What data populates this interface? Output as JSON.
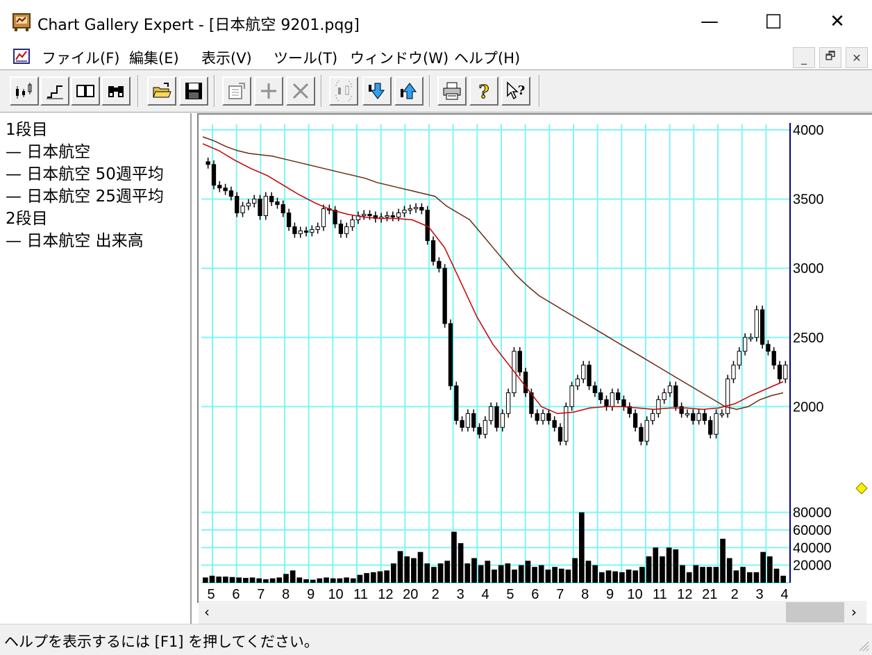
{
  "window": {
    "title": "Chart Gallery Expert - [日本航空 9201.pqg]",
    "minimize": "—",
    "maximize": "☐",
    "close": "✕"
  },
  "menu": [
    {
      "label": "ファイル(F)"
    },
    {
      "label": "編集(E)"
    },
    {
      "label": "表示(V)"
    },
    {
      "label": "ツール(T)"
    },
    {
      "label": "ウィンドウ(W)"
    },
    {
      "label": "ヘルプ(H)"
    }
  ],
  "mdi": {
    "minimize": "_",
    "restore": "🗗",
    "close": "✕"
  },
  "toolbar": [
    {
      "icon": "candlestick-chart-icon"
    },
    {
      "icon": "step-line-icon"
    },
    {
      "icon": "split-view-icon"
    },
    {
      "icon": "binoculars-icon"
    },
    {
      "icon": "open-folder-icon"
    },
    {
      "icon": "save-disk-icon"
    },
    {
      "icon": "properties-icon"
    },
    {
      "icon": "add-plus-icon"
    },
    {
      "icon": "delete-x-icon"
    },
    {
      "icon": "candle-refresh-icon"
    },
    {
      "icon": "move-down-icon"
    },
    {
      "icon": "move-up-icon"
    },
    {
      "icon": "print-icon"
    },
    {
      "icon": "help-question-icon"
    },
    {
      "icon": "context-help-icon"
    }
  ],
  "legend": [
    {
      "text": "1段目"
    },
    {
      "text": "— 日本航空",
      "color": "#000000"
    },
    {
      "text": "— 日本航空 50週平均",
      "color": "#7a2a10"
    },
    {
      "text": "— 日本航空 25週平均",
      "color": "#c00000"
    },
    {
      "text": "2段目"
    },
    {
      "text": "— 日本航空 出来高",
      "color": "#000000"
    }
  ],
  "status": "ヘルプを表示するには [F1] を押してください。",
  "colors": {
    "grid": "#7ff5f5",
    "axis": "#000080",
    "ma50": "#6b2a10",
    "ma25": "#c80000",
    "candle": "#000000",
    "marker": "#ffee00"
  },
  "chart_data": {
    "type": "candlestick",
    "panes": [
      {
        "name": "price",
        "ylim": [
          1500,
          4000
        ],
        "yticks": [
          4000,
          3500,
          3000,
          2500,
          2000
        ]
      },
      {
        "name": "volume",
        "ylim": [
          0,
          90000
        ],
        "yticks": [
          80000,
          60000,
          40000,
          20000
        ]
      }
    ],
    "x_tick_labels": [
      "5",
      "6",
      "7",
      "8",
      "9",
      "10",
      "11",
      "12",
      "20",
      "2",
      "3",
      "4",
      "5",
      "6",
      "7",
      "8",
      "9",
      "10",
      "11",
      "12",
      "21",
      "2",
      "3",
      "4"
    ],
    "price_close": [
      3750,
      3600,
      3580,
      3560,
      3520,
      3400,
      3450,
      3470,
      3500,
      3380,
      3520,
      3480,
      3460,
      3400,
      3300,
      3250,
      3270,
      3260,
      3280,
      3300,
      3430,
      3420,
      3320,
      3250,
      3300,
      3350,
      3380,
      3390,
      3380,
      3360,
      3370,
      3380,
      3370,
      3400,
      3420,
      3430,
      3440,
      3420,
      3200,
      3050,
      3000,
      2600,
      2150,
      1900,
      1850,
      1950,
      1850,
      1800,
      1900,
      2000,
      1850,
      1950,
      2100,
      2400,
      2250,
      2100,
      1950,
      1900,
      1950,
      1900,
      1850,
      1750,
      2000,
      2150,
      2200,
      2300,
      2150,
      2100,
      2050,
      2000,
      2100,
      2050,
      2000,
      1950,
      1850,
      1750,
      1900,
      1950,
      2050,
      2100,
      2150,
      2000,
      1950,
      1950,
      1900,
      1950,
      1900,
      1800,
      1950,
      1950,
      2200,
      2300,
      2400,
      2500,
      2500,
      2700,
      2450,
      2400,
      2300,
      2200,
      2300
    ],
    "ma50": [
      3950,
      3920,
      3880,
      3850,
      3830,
      3820,
      3810,
      3790,
      3770,
      3750,
      3730,
      3710,
      3690,
      3670,
      3650,
      3620,
      3600,
      3580,
      3560,
      3540,
      3520,
      3450,
      3400,
      3350,
      3250,
      3150,
      3050,
      2950,
      2870,
      2800,
      2750,
      2700,
      2650,
      2600,
      2550,
      2500,
      2450,
      2400,
      2350,
      2300,
      2250,
      2200,
      2150,
      2100,
      2050,
      2000,
      1980,
      2000,
      2050,
      2080,
      2100
    ],
    "ma25": [
      3900,
      3850,
      3780,
      3720,
      3670,
      3600,
      3530,
      3470,
      3420,
      3390,
      3370,
      3360,
      3360,
      3350,
      3300,
      3150,
      2900,
      2650,
      2450,
      2300,
      2150,
      2000,
      1950,
      1960,
      1990,
      2000,
      2000,
      1990,
      1980,
      1990,
      1990,
      1980,
      1990,
      2020,
      2080,
      2130,
      2180
    ],
    "volume": [
      6000,
      8000,
      7000,
      7000,
      6500,
      6000,
      5500,
      6000,
      5000,
      4000,
      5000,
      6000,
      10000,
      14000,
      6000,
      4000,
      3500,
      5000,
      6000,
      5000,
      5000,
      6000,
      5000,
      9000,
      11000,
      12000,
      13000,
      14000,
      22000,
      36000,
      30000,
      28000,
      35000,
      22000,
      18000,
      22000,
      25000,
      58000,
      45000,
      22000,
      28000,
      20000,
      25000,
      15000,
      20000,
      22000,
      15000,
      20000,
      25000,
      18000,
      20000,
      15000,
      18000,
      16000,
      15000,
      28000,
      80000,
      25000,
      20000,
      12000,
      14000,
      13000,
      12000,
      15000,
      14000,
      18000,
      30000,
      40000,
      30000,
      40000,
      38000,
      20000,
      12000,
      20000,
      18000,
      18000,
      18000,
      50000,
      28000,
      14000,
      18000,
      12000,
      12000,
      35000,
      30000,
      16000,
      8000
    ],
    "legend_position": "left-panel",
    "grid": true
  }
}
